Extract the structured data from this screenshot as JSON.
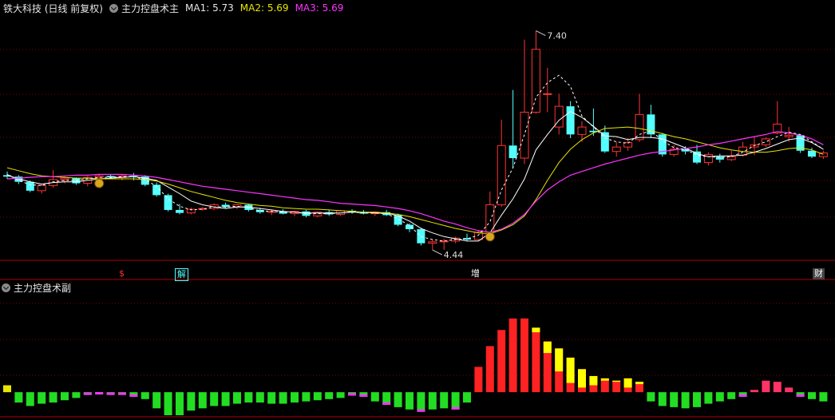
{
  "header": {
    "title": "铁大科技 (日线 前复权)",
    "indicator": "主力控盘术主",
    "ma1": "MA1: 5.73",
    "ma2": "MA2: 5.69",
    "ma3": "MA3: 5.69"
  },
  "sub_header": {
    "indicator": "主力控盘术副"
  },
  "colors": {
    "up": "#ff3333",
    "down": "#54ffff",
    "ma1": "#ffffff",
    "ma2": "#e6e600",
    "ma3": "#ff33ff",
    "grid": "#7a0000",
    "frame": "#b00000"
  },
  "annotations": {
    "high_label": "7.40",
    "low_label": "4.44"
  },
  "markers": [
    {
      "text": "$",
      "color": "#ff3333"
    },
    {
      "text": "解",
      "color": "#54ffff"
    },
    {
      "text": "增",
      "color": "#ffffff"
    },
    {
      "text": "财",
      "color": "#ffffff"
    }
  ],
  "chart_data": [
    {
      "type": "candlestick",
      "title": "主力控盘术主",
      "ylim": [
        4.3,
        7.6
      ],
      "series": [
        {
          "name": "candles",
          "ohlc": [
            [
              5.45,
              5.5,
              5.4,
              5.43
            ],
            [
              5.43,
              5.45,
              5.33,
              5.36
            ],
            [
              5.36,
              5.38,
              5.22,
              5.24
            ],
            [
              5.24,
              5.33,
              5.2,
              5.31
            ],
            [
              5.31,
              5.52,
              5.28,
              5.39
            ],
            [
              5.39,
              5.43,
              5.34,
              5.41
            ],
            [
              5.41,
              5.42,
              5.32,
              5.34
            ],
            [
              5.34,
              5.44,
              5.3,
              5.42
            ],
            [
              5.42,
              5.47,
              5.35,
              5.44
            ],
            [
              5.44,
              5.46,
              5.4,
              5.42
            ],
            [
              5.42,
              5.46,
              5.38,
              5.44
            ],
            [
              5.44,
              5.48,
              5.38,
              5.43
            ],
            [
              5.43,
              5.45,
              5.3,
              5.32
            ],
            [
              5.32,
              5.35,
              5.16,
              5.18
            ],
            [
              5.18,
              5.2,
              4.96,
              4.98
            ],
            [
              4.98,
              5.06,
              4.92,
              4.94
            ],
            [
              4.94,
              5.01,
              4.92,
              4.99
            ],
            [
              4.99,
              5.02,
              4.97,
              5.0
            ],
            [
              5.0,
              5.07,
              4.98,
              5.05
            ],
            [
              5.05,
              5.08,
              5.0,
              5.02
            ],
            [
              5.02,
              5.06,
              4.99,
              5.05
            ],
            [
              5.05,
              5.06,
              4.96,
              4.98
            ],
            [
              4.98,
              5.01,
              4.93,
              4.95
            ],
            [
              4.95,
              4.98,
              4.91,
              4.96
            ],
            [
              4.96,
              4.99,
              4.92,
              4.93
            ],
            [
              4.93,
              4.97,
              4.9,
              4.96
            ],
            [
              4.96,
              4.98,
              4.88,
              4.9
            ],
            [
              4.9,
              4.96,
              4.88,
              4.95
            ],
            [
              4.95,
              4.98,
              4.9,
              4.92
            ],
            [
              4.92,
              4.98,
              4.9,
              4.97
            ],
            [
              4.97,
              4.99,
              4.93,
              4.95
            ],
            [
              4.95,
              4.98,
              4.92,
              4.93
            ],
            [
              4.93,
              4.96,
              4.9,
              4.95
            ],
            [
              4.95,
              4.98,
              4.9,
              4.91
            ],
            [
              4.91,
              4.93,
              4.76,
              4.78
            ],
            [
              4.78,
              4.8,
              4.68,
              4.72
            ],
            [
              4.72,
              4.74,
              4.5,
              4.53
            ],
            [
              4.53,
              4.58,
              4.44,
              4.55
            ],
            [
              4.55,
              4.59,
              4.44,
              4.56
            ],
            [
              4.56,
              4.62,
              4.53,
              4.6
            ],
            [
              4.6,
              4.66,
              4.56,
              4.58
            ],
            [
              4.58,
              4.7,
              4.57,
              4.68
            ],
            [
              4.68,
              5.23,
              4.65,
              5.05
            ],
            [
              5.05,
              6.2,
              5.02,
              5.85
            ],
            [
              5.85,
              6.6,
              5.55,
              5.68
            ],
            [
              5.68,
              7.28,
              5.6,
              6.3
            ],
            [
              6.3,
              7.4,
              6.28,
              7.15
            ],
            [
              6.55,
              6.9,
              6.3,
              6.55
            ],
            [
              6.1,
              6.55,
              6.0,
              6.38
            ],
            [
              6.38,
              6.45,
              5.95,
              6.0
            ],
            [
              6.0,
              6.18,
              5.9,
              6.1
            ],
            [
              6.05,
              6.35,
              5.98,
              6.03
            ],
            [
              6.03,
              6.12,
              5.75,
              5.77
            ],
            [
              5.77,
              5.9,
              5.7,
              5.83
            ],
            [
              5.83,
              5.95,
              5.78,
              5.89
            ],
            [
              5.93,
              6.55,
              5.9,
              6.27
            ],
            [
              6.27,
              6.4,
              5.95,
              6.0
            ],
            [
              6.0,
              6.02,
              5.7,
              5.73
            ],
            [
              5.73,
              5.86,
              5.7,
              5.8
            ],
            [
              5.8,
              5.84,
              5.73,
              5.77
            ],
            [
              5.77,
              5.86,
              5.6,
              5.62
            ],
            [
              5.62,
              5.76,
              5.58,
              5.73
            ],
            [
              5.7,
              5.74,
              5.62,
              5.66
            ],
            [
              5.66,
              5.78,
              5.64,
              5.7
            ],
            [
              5.72,
              5.9,
              5.7,
              5.83
            ],
            [
              5.83,
              5.97,
              5.72,
              5.86
            ],
            [
              5.86,
              5.96,
              5.83,
              5.94
            ],
            [
              6.02,
              6.45,
              6.0,
              6.14
            ],
            [
              5.97,
              6.1,
              5.9,
              5.99
            ],
            [
              5.99,
              6.0,
              5.75,
              5.78
            ],
            [
              5.78,
              5.82,
              5.68,
              5.7
            ],
            [
              5.7,
              5.78,
              5.67,
              5.75
            ]
          ]
        },
        {
          "name": "MA1",
          "values": [
            5.45,
            5.4,
            5.36,
            5.33,
            5.35,
            5.36,
            5.36,
            5.38,
            5.4,
            5.41,
            5.42,
            5.43,
            5.41,
            5.38,
            5.29,
            5.2,
            5.1,
            5.05,
            5.02,
            5.0,
            5.02,
            5.02,
            5.0,
            4.98,
            4.96,
            4.95,
            4.94,
            4.94,
            4.94,
            4.94,
            4.95,
            4.95,
            4.94,
            4.94,
            4.9,
            4.83,
            4.73,
            4.67,
            4.62,
            4.59,
            4.56,
            4.56,
            4.67,
            4.91,
            5.13,
            5.4,
            5.79,
            6.0,
            6.19,
            6.31,
            6.23,
            6.11,
            5.98,
            5.97,
            5.93,
            5.96,
            5.96,
            5.94,
            5.88,
            5.82,
            5.74,
            5.7,
            5.71,
            5.71,
            5.72,
            5.76,
            5.81,
            5.87,
            5.93,
            5.95,
            5.89,
            5.8
          ]
        },
        {
          "name": "MA2",
          "values": [
            5.55,
            5.51,
            5.47,
            5.44,
            5.43,
            5.42,
            5.41,
            5.41,
            5.4,
            5.4,
            5.4,
            5.4,
            5.39,
            5.37,
            5.33,
            5.28,
            5.23,
            5.19,
            5.15,
            5.11,
            5.08,
            5.06,
            5.04,
            5.03,
            5.01,
            5.0,
            4.99,
            4.99,
            4.98,
            4.97,
            4.96,
            4.95,
            4.95,
            4.94,
            4.92,
            4.89,
            4.85,
            4.81,
            4.77,
            4.73,
            4.7,
            4.67,
            4.66,
            4.71,
            4.78,
            4.9,
            5.12,
            5.38,
            5.62,
            5.8,
            5.93,
            6.02,
            6.08,
            6.09,
            6.1,
            6.08,
            6.05,
            6.01,
            5.97,
            5.94,
            5.9,
            5.86,
            5.82,
            5.79,
            5.77,
            5.76,
            5.76,
            5.78,
            5.81,
            5.82,
            5.79,
            5.73
          ]
        },
        {
          "name": "MA3",
          "values": [
            5.4,
            5.41,
            5.42,
            5.43,
            5.43,
            5.44,
            5.45,
            5.45,
            5.46,
            5.46,
            5.46,
            5.45,
            5.44,
            5.42,
            5.39,
            5.36,
            5.33,
            5.3,
            5.28,
            5.26,
            5.24,
            5.22,
            5.2,
            5.18,
            5.16,
            5.14,
            5.12,
            5.11,
            5.09,
            5.07,
            5.06,
            5.05,
            5.04,
            5.02,
            5.0,
            4.97,
            4.93,
            4.88,
            4.83,
            4.79,
            4.74,
            4.7,
            4.68,
            4.72,
            4.8,
            4.92,
            5.1,
            5.25,
            5.36,
            5.45,
            5.5,
            5.55,
            5.6,
            5.64,
            5.68,
            5.72,
            5.75,
            5.77,
            5.79,
            5.81,
            5.83,
            5.86,
            5.88,
            5.91,
            5.94,
            5.97,
            6.0,
            6.04,
            6.02,
            5.99,
            5.94,
            5.86
          ]
        },
        {
          "name": "dashed",
          "values": [
            5.46,
            5.38,
            5.32,
            5.31,
            5.36,
            5.38,
            5.38,
            5.4,
            5.42,
            5.42,
            5.43,
            5.43,
            5.39,
            5.3,
            5.13,
            5.03,
            4.98,
            4.99,
            5.02,
            5.02,
            5.03,
            5.01,
            4.97,
            4.96,
            4.95,
            4.95,
            4.93,
            4.93,
            4.93,
            4.94,
            4.95,
            4.94,
            4.94,
            4.93,
            4.86,
            4.77,
            4.62,
            4.58,
            4.56,
            4.58,
            4.59,
            4.64,
            4.82,
            5.25,
            5.55,
            6.0,
            6.5,
            6.7,
            6.8,
            6.65,
            6.25,
            6.1,
            5.95,
            5.9,
            5.88,
            6.0,
            6.05,
            5.92,
            5.82,
            5.8,
            5.72,
            5.7,
            5.69,
            5.7,
            5.76,
            5.85,
            5.9,
            5.97,
            6.03,
            6.0,
            5.9,
            5.8
          ]
        }
      ]
    },
    {
      "type": "bar",
      "title": "主力控盘术副",
      "ylim": [
        -1.0,
        4.2
      ],
      "series": [
        {
          "name": "bars",
          "values": [
            0.3,
            -0.45,
            -0.6,
            -0.5,
            -0.45,
            -0.35,
            -0.25,
            -0.12,
            -0.1,
            -0.12,
            -0.12,
            -0.2,
            -0.3,
            -0.7,
            -1.0,
            -1.0,
            -0.8,
            -0.7,
            -0.6,
            -0.6,
            -0.5,
            -0.45,
            -0.45,
            -0.5,
            -0.5,
            -0.45,
            -0.4,
            -0.35,
            -0.3,
            -0.25,
            -0.15,
            -0.2,
            -0.4,
            -0.55,
            -0.65,
            -0.75,
            -0.85,
            -0.75,
            -0.7,
            -0.75,
            -0.45,
            1.1,
            2.0,
            2.7,
            3.2,
            3.2,
            2.8,
            2.2,
            1.9,
            1.5,
            1.0,
            0.7,
            0.6,
            0.5,
            0.6,
            0.45,
            -0.4,
            -0.6,
            -0.65,
            -0.7,
            -0.65,
            -0.5,
            -0.4,
            -0.3,
            -0.2,
            0.1,
            0.5,
            0.45,
            0.2,
            -0.2,
            -0.3,
            -0.4
          ]
        },
        {
          "name": "yellow_tops",
          "values": [
            0,
            0,
            0,
            0,
            0,
            0,
            0,
            0,
            0,
            0,
            0,
            0,
            0,
            0,
            0,
            0,
            0,
            0,
            0,
            0,
            0,
            0,
            0,
            0,
            0,
            0,
            0,
            0,
            0,
            0,
            0,
            0,
            0,
            0,
            0,
            0,
            0,
            0,
            0,
            0,
            0,
            0,
            0,
            0,
            0,
            0,
            0.2,
            0.5,
            1.0,
            1.1,
            0.8,
            0.4,
            0.1,
            0.05,
            0.4,
            0.1,
            0,
            0,
            0,
            0,
            0,
            0,
            0,
            0,
            0,
            0,
            0,
            0,
            0,
            0,
            0,
            0
          ]
        }
      ]
    }
  ]
}
